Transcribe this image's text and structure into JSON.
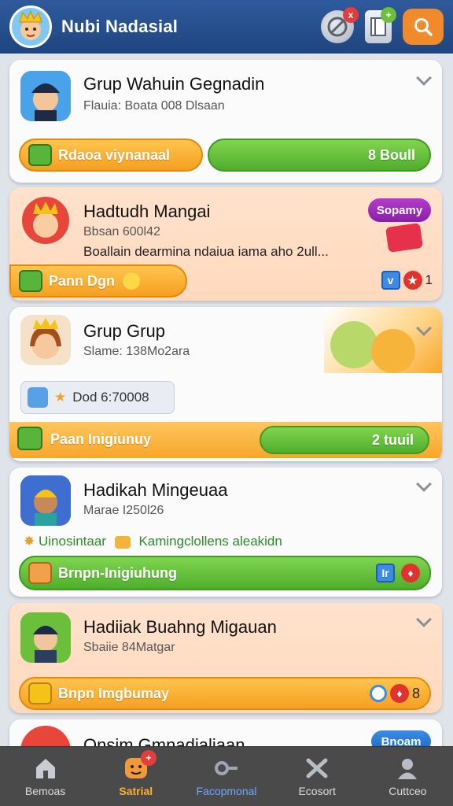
{
  "header": {
    "title": "Nubi Nadasial",
    "icons": [
      "avatar-logo",
      "no-deal-icon",
      "book-icon",
      "search-icon"
    ],
    "badges": {
      "no_deal": "x",
      "book": "+"
    }
  },
  "cards": [
    {
      "title": "Grup Wahuin Gegnadin",
      "subtitle": "Flauia: Boata 008 Dlsaan",
      "left_button": "Rdaoa viynanaal",
      "right_button": "8 Boull"
    },
    {
      "title": "Hadtudh Mangai",
      "subtitle": "Bbsan 600l42",
      "description": "Boallain dearmina ndaiua iama aho 2ull...",
      "tag": "Sopamy",
      "button": "Pann Dgn",
      "count": "1"
    },
    {
      "title": "Grup Grup",
      "subtitle": "Slame: 138Mo2ara",
      "stat": "Dod 6:70008",
      "band_label": "Paan Inigiunuy",
      "band_button": "2 tuuil"
    },
    {
      "title": "Hadikah Mingeuaa",
      "subtitle": "Marae I250l26",
      "promo": "Uinosintaar",
      "promo2": "Kamingclollens aleakidn",
      "band_label": "Brnpn-Inigiuhung",
      "mini_label": "Ir"
    },
    {
      "title": "Hadiiak Buahng Migauan",
      "subtitle": "Sbaiie 84Matgar",
      "button": "Bnpn Imgbumay",
      "count": "8"
    },
    {
      "title": "Onsim Gmnadialiaan",
      "tag": "Bnoam"
    }
  ],
  "bottom_nav": [
    {
      "label": "Bemoas",
      "icon": "home-icon"
    },
    {
      "label": "Satrial",
      "icon": "smiley-icon",
      "badge": "+"
    },
    {
      "label": "Facopmonal",
      "icon": "key-icon"
    },
    {
      "label": "Ecosort",
      "icon": "tools-icon"
    },
    {
      "label": "Cuttceo",
      "icon": "profile-icon"
    }
  ],
  "colors": {
    "header": "#2f5a9c",
    "accent_orange": "#f5a020",
    "accent_green": "#4fae2d",
    "nav_bg": "#4a4a4a"
  }
}
